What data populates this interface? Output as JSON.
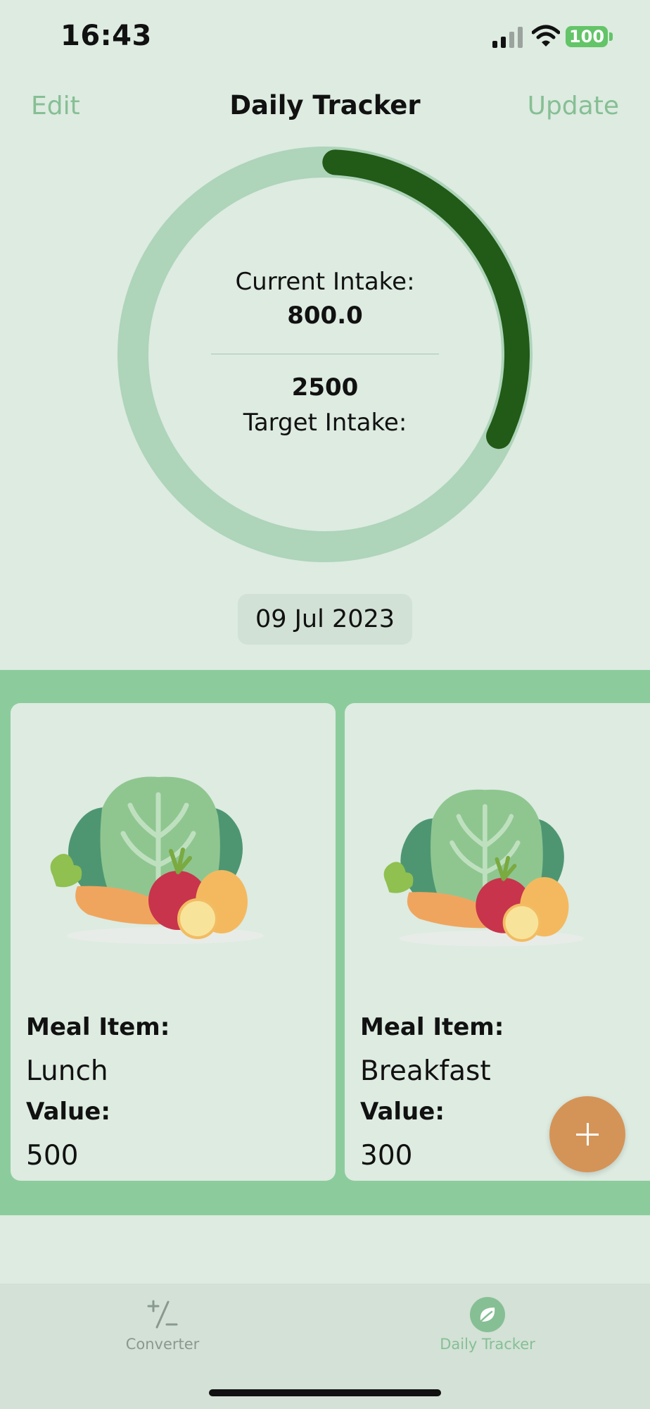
{
  "status_bar": {
    "time": "16:43",
    "battery": "100"
  },
  "nav": {
    "left_button": "Edit",
    "title": "Daily Tracker",
    "right_button": "Update"
  },
  "tracker": {
    "current_label": "Current Intake:",
    "current_value": "800.0",
    "target_value": "2500",
    "target_label": "Target Intake:",
    "progress_fraction": 0.32,
    "colors": {
      "ring_track": "#aed4ba",
      "ring_progress": "#225a17"
    }
  },
  "date": "09 Jul 2023",
  "meals": [
    {
      "item_label": "Meal Item:",
      "item": "Lunch",
      "value_label": "Value:",
      "value": "500"
    },
    {
      "item_label": "Meal Item:",
      "item": "Breakfast",
      "value_label": "Value:",
      "value": "300"
    }
  ],
  "fab": {
    "icon": "plus-icon",
    "color": "#d49458"
  },
  "tabs": [
    {
      "label": "Converter",
      "icon": "plus-minus-icon",
      "selected": false
    },
    {
      "label": "Daily Tracker",
      "icon": "leaf-icon",
      "selected": true
    }
  ]
}
